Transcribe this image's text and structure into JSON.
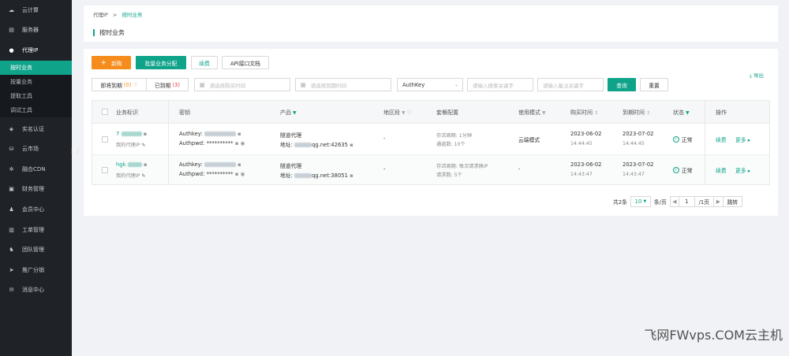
{
  "sidebar": {
    "items": [
      {
        "icon": "cloud-icon",
        "label": "云计算"
      },
      {
        "icon": "server-icon",
        "label": "服务器"
      },
      {
        "icon": "location-icon",
        "label": "代理IP"
      },
      {
        "icon": "shield-icon",
        "label": "实名认证"
      },
      {
        "icon": "cloud-market-icon",
        "label": "云市场"
      },
      {
        "icon": "cdn-icon",
        "label": "融合CDN"
      },
      {
        "icon": "wallet-icon",
        "label": "财务管理"
      },
      {
        "icon": "user-icon",
        "label": "会员中心"
      },
      {
        "icon": "ticket-icon",
        "label": "工单管理"
      },
      {
        "icon": "team-icon",
        "label": "团队管理"
      },
      {
        "icon": "send-icon",
        "label": "推广分销"
      },
      {
        "icon": "message-icon",
        "label": "消息中心"
      }
    ],
    "sub_items": [
      "按时业务",
      "按量业务",
      "提取工具",
      "调试工具"
    ]
  },
  "breadcrumb": {
    "parent": "代理IP",
    "separator": ">",
    "current": "按时业务"
  },
  "page_title": "按时业务",
  "toolbar": {
    "buy": "新购",
    "batch_assign": "批量业务分配",
    "renew": "续费",
    "api_doc": "API接口文档",
    "export": "导出"
  },
  "filters": {
    "expiring_label": "即将到期",
    "expiring_count": "(0)",
    "expired_label": "已到期",
    "expired_count": "(3)",
    "buy_time_placeholder": "请选择购买时间",
    "expire_time_placeholder": "请选择到期时间",
    "key_select": "AuthKey",
    "search_key_placeholder": "请输入搜索关键字",
    "remark_placeholder": "请输入备注关键字",
    "query": "查询",
    "reset": "重置"
  },
  "table": {
    "headers": {
      "id": "业务标识",
      "key": "密钥",
      "product": "产品",
      "region": "地区段",
      "plan": "套餐配置",
      "mode": "使用模式",
      "buy_time": "购买时间",
      "expire_time": "到期时间",
      "status": "状态",
      "ops": "操作"
    },
    "rows": [
      {
        "id": "7",
        "remark": "我的代理IP",
        "authkey_label": "Authkey:",
        "authpwd_label": "Authpwd:",
        "authpwd": "**********",
        "product_name": "隧道代理",
        "addr_label": "地址:",
        "addr_suffix": "qg.net:42635",
        "region": "-",
        "plan_line1": "存活周期: 1分钟",
        "plan_line2": "通道数: 10个",
        "mode": "云端模式",
        "buy_date": "2023-06-02",
        "buy_time": "14:44:45",
        "expire_date": "2023-07-02",
        "expire_time": "14:44:45",
        "status": "正常",
        "renew": "续费",
        "more": "更多"
      },
      {
        "id": "hgk",
        "remark": "我的代理IP",
        "authkey_label": "Authkey:",
        "authpwd_label": "Authpwd:",
        "authpwd": "**********",
        "product_name": "隧道代理",
        "addr_label": "地址:",
        "addr_suffix": "qg.net:38051",
        "region": "-",
        "plan_line1": "存活周期: 每次请求换IP",
        "plan_line2": "请求数: 5个",
        "mode": "-",
        "buy_date": "2023-06-02",
        "buy_time": "14:43:47",
        "expire_date": "2023-07-02",
        "expire_time": "14:43:47",
        "status": "正常",
        "renew": "续费",
        "more": "更多"
      }
    ]
  },
  "pagination": {
    "total": "共2条",
    "page_size": "10",
    "per_page_suffix": "条/页",
    "current": "1",
    "total_pages": "/1页",
    "jump": "跳转"
  },
  "watermark": "飞网FWvps.COM云主机",
  "colors": {
    "accent": "#0fa38a",
    "orange": "#f58c1c",
    "sidebar_bg": "#1f2227"
  }
}
